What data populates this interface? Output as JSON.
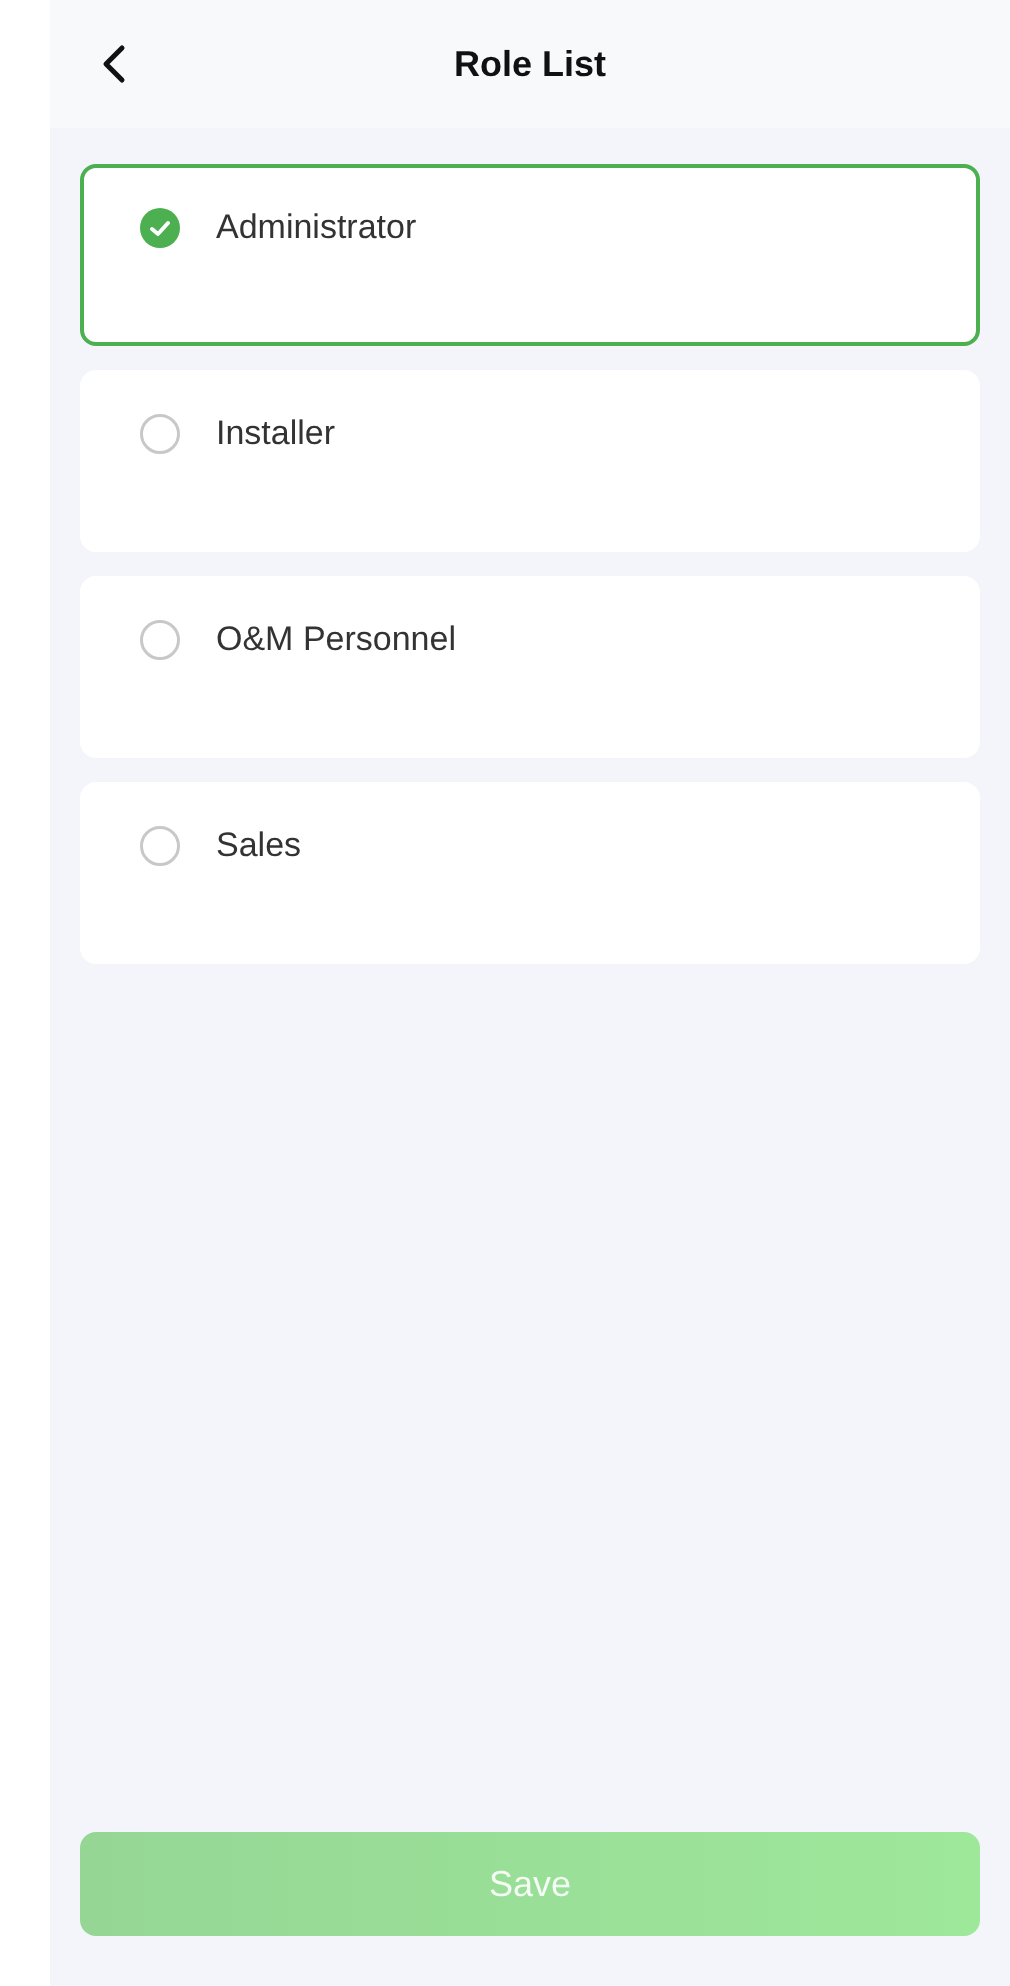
{
  "header": {
    "title": "Role List"
  },
  "roles": [
    {
      "label": "Administrator",
      "selected": true
    },
    {
      "label": "Installer",
      "selected": false
    },
    {
      "label": "O&M Personnel",
      "selected": false
    },
    {
      "label": "Sales",
      "selected": false
    }
  ],
  "save_button": {
    "label": "Save",
    "disabled": true
  }
}
